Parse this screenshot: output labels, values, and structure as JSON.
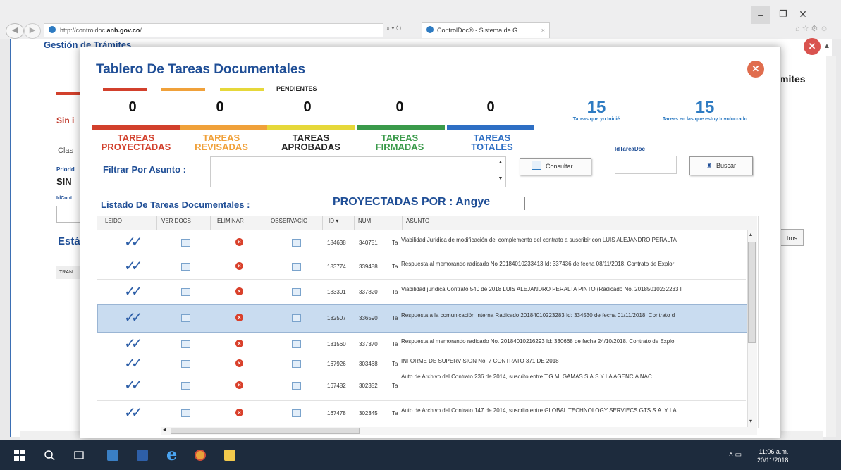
{
  "browser": {
    "url_prefix": "http://controldoc.",
    "url_host": "anh.gov.co",
    "url_suffix": "/",
    "address_controls": "⌕ ▾ ↻",
    "tab_title": "ControlDoc® - Sistema de G...",
    "tab_close": "×",
    "min": "–",
    "max": "❐",
    "close": "✕",
    "tools": "⌂☆⚙☺"
  },
  "background_page": {
    "title": "Gestión de Trámites",
    "right_heading": "mites",
    "sin_label": "Sin i",
    "clas_label": "Clas",
    "priorid_label": "Priorid",
    "sin_value": "SIN",
    "idcont_label": "IdCont",
    "esta_label": "Está",
    "tran_label": "TRAN",
    "tros_button": "tros"
  },
  "modal": {
    "title": "Tablero De Tareas Documentales",
    "close": "✕",
    "pending_label": "PENDIENTES",
    "categories": [
      {
        "count": "0",
        "label_line1": "TAREAS",
        "label_line2": "PROYECTADAS",
        "color": "#d2402c"
      },
      {
        "count": "0",
        "label_line1": "TAREAS",
        "label_line2": "REVISADAS",
        "color": "#f0a13a"
      },
      {
        "count": "0",
        "label_line1": "TAREAS",
        "label_line2": "APROBADAS",
        "color": "#222222"
      },
      {
        "count": "0",
        "label_line1": "TAREAS",
        "label_line2": "FIRMADAS",
        "color": "#3a9a4a"
      },
      {
        "count": "0",
        "label_line1": "TAREAS",
        "label_line2": "TOTALES",
        "color": "#2e6fc4"
      }
    ],
    "bar_colors": [
      "#d2402c",
      "#f0a13a",
      "#e6d83a",
      "#3a9a4a",
      "#2e6fc4"
    ],
    "stats": [
      {
        "number": "15",
        "label": "Tareas que yo Inicié"
      },
      {
        "number": "15",
        "label": "Tareas en las que estoy Involucrado"
      }
    ],
    "filter_label": "Filtrar Por Asunto :",
    "spin_up": "▲",
    "spin_down": "▼",
    "consultar_label": "Consultar",
    "idtarea_label": "IdTareaDoc",
    "buscar_icon": "♜",
    "buscar_label": "Buscar",
    "list_label": "Listado De Tareas Documentales :",
    "proyectadas_heading": "PROYECTADAS POR : Angye"
  },
  "table": {
    "columns": [
      "LEIDO",
      "VER DOCS",
      "ELIMINAR",
      "OBSERVACIO",
      "ID ▾",
      "NUMI",
      "ASUNTO"
    ],
    "check_glyph": "✓✓",
    "delete_glyph": "×",
    "rows": [
      {
        "id": "184638",
        "num": "340751",
        "t": "Ta",
        "asunto": "Viabilidad Jurídica de modificación del complemento del contrato a suscribir con LUIS ALEJANDRO PERALTA"
      },
      {
        "id": "183774",
        "num": "339488",
        "t": "Ta",
        "asunto": "Respuesta al memorando radicado No 20184010233413 Id: 337436 de fecha 08/11/2018. Contrato de Explor"
      },
      {
        "id": "183301",
        "num": "337820",
        "t": "Ta",
        "asunto": "Viabilidad jurídica Contrato 540 de 2018 LUIS ALEJANDRO PERALTA PINTO (Radicado No. 20185010232233 I"
      },
      {
        "id": "182507",
        "num": "336590",
        "t": "Ta",
        "asunto": "Respuesta a la comunicación interna Radicado 20184010223283 Id: 334530 de fecha 01/11/2018. Contrato d"
      },
      {
        "id": "181560",
        "num": "337370",
        "t": "Ta",
        "asunto": "Respuesta al memorando radicado No. 20184010216293 Id: 330668 de fecha 24/10/2018. Contrato de Explo"
      },
      {
        "id": "167926",
        "num": "303468",
        "t": "Ta",
        "asunto": "INFORME DE SUPERVISION No. 7 CONTRATO 371 DE 2018"
      },
      {
        "id": "167482",
        "num": "302352",
        "t": "Ta",
        "asunto": "Auto de Archivo del Contrato 236 de 2014, suscrito entre T.G.M. GAMAS S.A.S Y LA AGENCIA NAC"
      },
      {
        "id": "167478",
        "num": "302345",
        "t": "Ta",
        "asunto": "Auto de Archivo del Contrato 147 de 2014, suscrito entre GLOBAL TECHNOLOGY SERVIECS GTS S.A. Y LA"
      }
    ],
    "scroll_up": "▴",
    "scroll_down": "▾",
    "scroll_left": "◂"
  },
  "taskbar": {
    "time": "11:06 a.m.",
    "date": "20/11/2018",
    "tray": "˄ ▭"
  }
}
